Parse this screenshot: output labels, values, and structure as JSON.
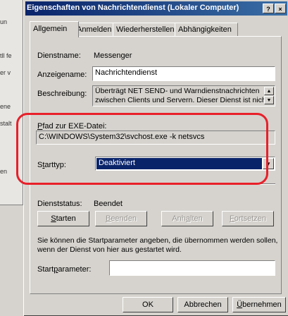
{
  "background_window": {
    "fragments": [
      "un",
      "tll fe",
      "er v",
      "ene",
      "stalt",
      "en"
    ]
  },
  "dialog": {
    "title": "Eigenschaften von Nachrichtendienst (Lokaler Computer)",
    "help_button": "?",
    "close_button": "×",
    "tabs": [
      {
        "label": "Allgemein",
        "active": true
      },
      {
        "label": "Anmelden",
        "active": false
      },
      {
        "label": "Wiederherstellen",
        "active": false
      },
      {
        "label": "Abhängigkeiten",
        "active": false
      }
    ],
    "dienstname": {
      "label": "Dienstname:",
      "value": "Messenger"
    },
    "anzeigename": {
      "label": "Anzeigename:",
      "value": "Nachrichtendienst"
    },
    "beschreibung": {
      "label": "Beschreibung:",
      "line1": "Überträgt NET SEND- und Warndienstnachrichten",
      "line2": "zwischen Clients und Servern. Dieser Dienst ist nicht"
    },
    "exe_pfad": {
      "label": "Pfad zur EXE-Datei:",
      "value": "C:\\WINDOWS\\System32\\svchost.exe -k netsvcs"
    },
    "starttyp": {
      "label": "Starttyp:",
      "value": "Deaktiviert"
    },
    "dienststatus": {
      "label": "Dienststatus:",
      "value": "Beendet"
    },
    "buttons": {
      "starten": "Starten",
      "beenden": "Beenden",
      "anhalten": "Anhalten",
      "fortsetzen": "Fortsetzen"
    },
    "hint_line1": "Sie können die Startparameter angeben, die übernommen werden sollen,",
    "hint_line2": "wenn der Dienst von hier aus gestartet wird.",
    "startparameter": {
      "label": "Startparameter:",
      "value": ""
    },
    "footer": {
      "ok": "OK",
      "abbrechen": "Abbrechen",
      "uebernehmen": "Übernehmen"
    },
    "highlight_color": "#e8202a",
    "selection_color": "#0a246a"
  }
}
